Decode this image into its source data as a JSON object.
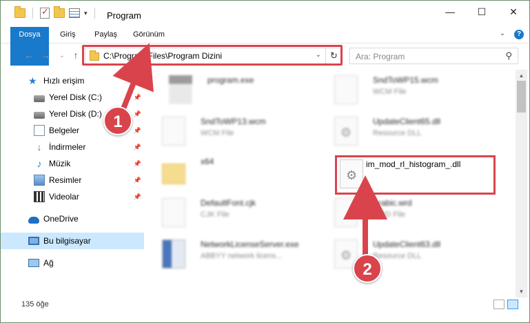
{
  "window": {
    "title": "Program",
    "minimize": "—",
    "maximize": "☐",
    "close": "✕"
  },
  "ribbon": {
    "tabs": [
      "Dosya",
      "Giriş",
      "Paylaş",
      "Görünüm"
    ]
  },
  "navigation": {
    "back": "←",
    "forward": "→",
    "recent": "⌄",
    "up": "↑",
    "address": "C:\\Program Files\\Program Dizini",
    "refresh": "↻",
    "search_placeholder": "Ara: Program"
  },
  "sidebar": {
    "items": [
      {
        "label": "Hızlı erişim",
        "icon": "quick-access-icon"
      },
      {
        "label": "Yerel Disk (C:)",
        "icon": "disk-icon",
        "pinned": true
      },
      {
        "label": "Yerel Disk (D:)",
        "icon": "disk-icon",
        "pinned": true
      },
      {
        "label": "Belgeler",
        "icon": "documents-icon",
        "pinned": true
      },
      {
        "label": "İndirmeler",
        "icon": "downloads-icon",
        "pinned": true
      },
      {
        "label": "Müzik",
        "icon": "music-icon",
        "pinned": true
      },
      {
        "label": "Resimler",
        "icon": "pictures-icon",
        "pinned": true
      },
      {
        "label": "Videolar",
        "icon": "videos-icon",
        "pinned": true
      },
      {
        "label": "OneDrive",
        "icon": "onedrive-icon"
      },
      {
        "label": "Bu bilgisayar",
        "icon": "this-pc-icon",
        "selected": true
      },
      {
        "label": "Ağ",
        "icon": "network-icon"
      }
    ]
  },
  "files": [
    {
      "name": "program.exe",
      "type": "",
      "kind": "exe"
    },
    {
      "name": "SndToWP15.wcm",
      "type": "WCM File",
      "kind": "doc"
    },
    {
      "name": "SndToWP13.wcm",
      "type": "WCM File",
      "kind": "doc"
    },
    {
      "name": "UpdateClient65.dll",
      "type": "Resource DLL",
      "kind": "dll"
    },
    {
      "name": "x64",
      "type": "",
      "kind": "folder"
    },
    {
      "name": "im_mod_rl_histogram_.dll",
      "type": "",
      "kind": "dll"
    },
    {
      "name": "DefaultFont.cjk",
      "type": "CJK File",
      "kind": "doc"
    },
    {
      "name": "Arabic.wrd",
      "type": "WRD File",
      "kind": "doc"
    },
    {
      "name": "NetworkLicenseServer.exe",
      "type": "ABBYY network licens...",
      "kind": "app"
    },
    {
      "name": "UpdateClient63.dll",
      "type": "Resource DLL",
      "kind": "dll"
    }
  ],
  "status": {
    "item_count": "135 öğe"
  },
  "annotations": {
    "badge1": "1",
    "badge2": "2",
    "color": "#d9444c"
  }
}
